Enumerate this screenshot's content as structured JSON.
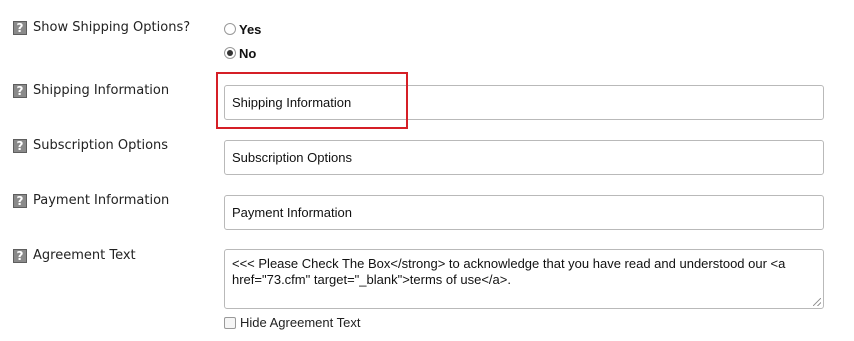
{
  "fields": {
    "show_shipping": {
      "label": "Show Shipping Options?",
      "options": [
        {
          "label": "Yes",
          "selected": false
        },
        {
          "label": "No",
          "selected": true
        }
      ]
    },
    "shipping_information": {
      "label": "Shipping Information",
      "value": "Shipping Information"
    },
    "subscription_options": {
      "label": "Subscription Options",
      "value": "Subscription Options"
    },
    "payment_information": {
      "label": "Payment Information",
      "value": "Payment Information"
    },
    "agreement_text": {
      "label": "Agreement Text",
      "value": "<<< Please Check The Box</strong> to acknowledge that you have read and understood our <a href=\"73.cfm\" target=\"_blank\">terms of use</a>."
    },
    "hide_agreement": {
      "label": "Hide Agreement Text",
      "checked": false
    }
  },
  "help_icon_glyph": "?",
  "highlight_color": "#d51f26"
}
